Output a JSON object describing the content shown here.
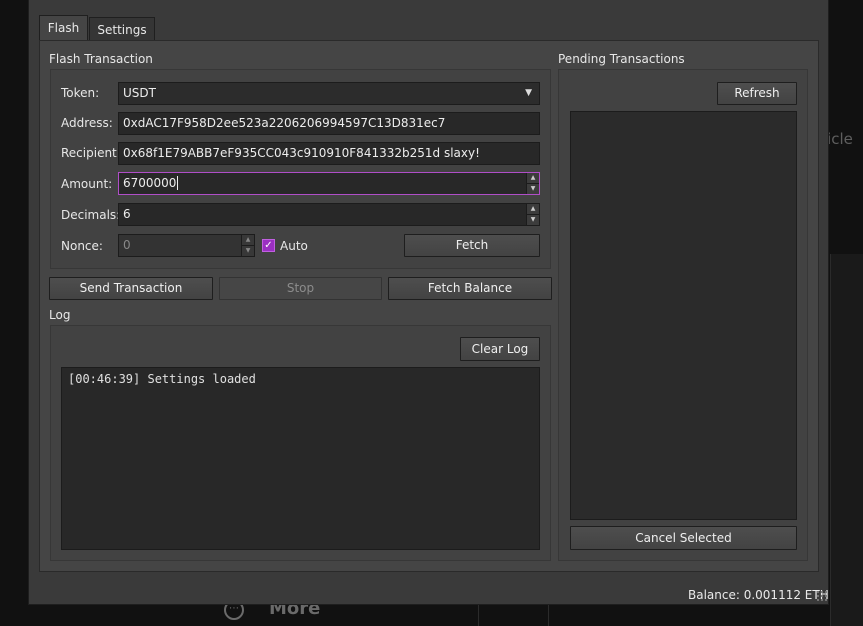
{
  "background": {
    "partial_text": "rticle",
    "more_label": "More",
    "more_icon": "ellipsis-circle-icon"
  },
  "tabs": [
    {
      "label": "Flash",
      "active": true
    },
    {
      "label": "Settings",
      "active": false
    }
  ],
  "flash_group": {
    "title": "Flash Transaction",
    "token": {
      "label": "Token:",
      "value": "USDT"
    },
    "address": {
      "label": "Address:",
      "value": "0xdAC17F958D2ee523a2206206994597C13D831ec7"
    },
    "recipient": {
      "label": "Recipient:",
      "value": "0x68f1E79ABB7eF935CC043c910910F841332b251d slaxy!"
    },
    "amount": {
      "label": "Amount:",
      "value": "6700000"
    },
    "decimals": {
      "label": "Decimals:",
      "value": "6"
    },
    "nonce": {
      "label": "Nonce:",
      "value": "0",
      "auto_label": "Auto",
      "auto_checked": true
    },
    "fetch_label": "Fetch"
  },
  "actions": {
    "send_label": "Send Transaction",
    "stop_label": "Stop",
    "fetch_balance_label": "Fetch Balance"
  },
  "log": {
    "title": "Log",
    "clear_label": "Clear Log",
    "entries": [
      "[00:46:39] Settings loaded"
    ]
  },
  "pending": {
    "title": "Pending Transactions",
    "refresh_label": "Refresh",
    "cancel_label": "Cancel Selected"
  },
  "status": {
    "balance": "Balance: 0.001112 ETH"
  },
  "colors": {
    "accent": "#9b2fc2",
    "focus_border": "#b04ec8"
  }
}
